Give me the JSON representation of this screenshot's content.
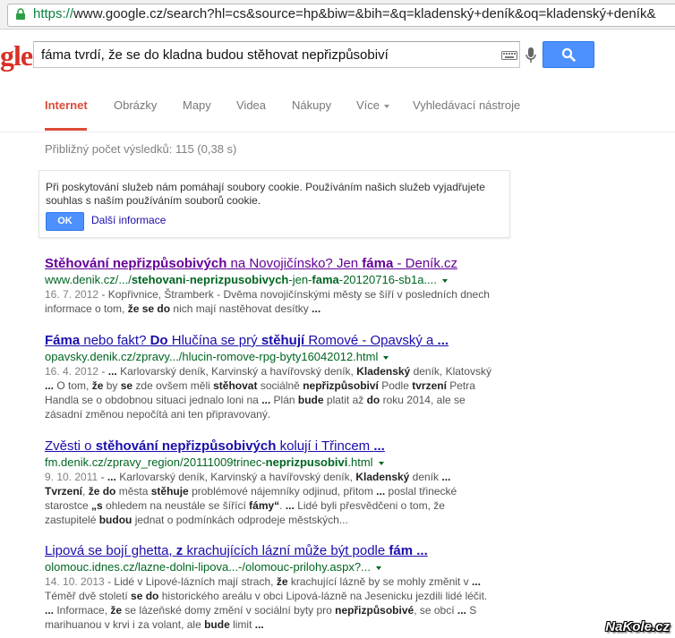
{
  "address_bar": {
    "scheme": "https://",
    "url_rest": "www.google.cz/search?hl=cs&source=hp&biw=&bih=&q=kladenský+deník&oq=kladenský+deník&"
  },
  "logo_text": "gle",
  "search": {
    "query": "fáma tvrdí, že se do kladna budou stěhovat nepřizpůsobiví"
  },
  "tabs": [
    {
      "label": "Internet",
      "active": true
    },
    {
      "label": "Obrázky"
    },
    {
      "label": "Mapy"
    },
    {
      "label": "Videa"
    },
    {
      "label": "Nákupy"
    },
    {
      "label": "Více"
    },
    {
      "label": "Vyhledávací nástroje"
    }
  ],
  "result_stats": "Přibližný počet výsledků: 115 (0,38 s)",
  "cookie": {
    "text": "Při poskytování služeb nám pomáhají soubory cookie. Používáním našich služeb vyjadřujete souhlas s naším používáním souborů cookie.",
    "ok_label": "OK",
    "more_label": "Další informace"
  },
  "results": [
    {
      "title_html": "<b>Stěhování nepřizpůsobivých</b> na Novojičínsko? Jen <b>fáma</b> - Deník.cz",
      "url_html": "www.denik.cz/.../<b>stehovani</b>-<b>neprizpusobivych</b>-jen-<b>fama</b>-20120716-sb1a....",
      "date": "16. 7. 2012",
      "snippet_html": "Kopřivnice, Štramberk - Dvěma novojičínskými městy se šíří v posledních dnech informace o tom, <b>že se do</b> nich mají nastěhovat desítky <b>...</b>",
      "visited": true
    },
    {
      "title_html": "<b>Fáma</b> nebo fakt? <b>Do</b> Hlučína se prý <b>stěhují</b> Romové - Opavský a <b>...</b>",
      "url_html": "opavsky.denik.cz/zpravy.../hlucin-romove-rpg-byty16042012.html",
      "date": "16. 4. 2012",
      "snippet_html": "<b>...</b> Karlovarský deník, Karvinský a havířovský deník, <b>Kladenský</b> deník, Klatovský <b>...</b> O tom, <b>že</b> by <b>se</b> zde ovšem měli <b>stěhovat</b> sociálně <b>nepřizpůsobiví</b> Podle <b>tvrzení</b> Petra Handla se o obdobnou situaci jednalo loni na <b>...</b> Plán <b>bude</b> platit až <b>do</b> roku 2014, ale se zásadní změnou nepočítá ani ten připravovaný.",
      "visited": false
    },
    {
      "title_html": "Zvěsti o <b>stěhování nepřizpůsobivých</b> kolují i Třincem <b>...</b>",
      "url_html": "fm.denik.cz/zpravy_region/20111009trinec-<b>neprizpusobivi</b>.html",
      "date": "9. 10. 2011",
      "snippet_html": "<b>...</b> Karlovarský deník, Karvinský a havířovský deník, <b>Kladenský</b> deník <b>...</b> <b>Tvrzení</b>, <b>že do</b> města <b>stěhuje</b> problémové nájemníky odjinud, přitom <b>...</b> poslal třinecké starostce <b>„s</b> ohledem na neustále se šířící <b>fámy“</b>. <b>...</b> Lidé byli přesvědčeni o tom, že zastupitelé <b>budou</b> jednat o podmínkách odprodeje městských...",
      "visited": false
    },
    {
      "title_html": "Lipová se bojí ghetta, <b>z</b> krachujících lázní může být podle <b>fám</b> <b>...</b>",
      "url_html": "olomouc.idnes.cz/lazne-dolni-lipova...-/olomouc-prilohy.aspx?...",
      "date": "14. 10. 2013",
      "snippet_html": "Lidé v Lipové-lázních mají strach, <b>že</b> krachující lázně by se mohly změnit v <b>...</b> Téměř dvě století <b>se do</b> historického areálu v obci Lipová-lázně na Jesenicku jezdili lidé léčit. <b>...</b> Informace, <b>že</b> se lázeňské domy změní v sociální byty pro <b>nepřizpůsobivé</b>, se obcí <b>...</b> S marihuanou v krvi i za volant, ale <b>bude</b> limit <b>...</b>",
      "visited": false
    }
  ],
  "watermark": "NaKole.cz",
  "colors": {
    "accent": "#dd4b39",
    "link": "#1a0dab",
    "visited": "#660099",
    "url": "#006621",
    "button": "#4d90fe"
  }
}
